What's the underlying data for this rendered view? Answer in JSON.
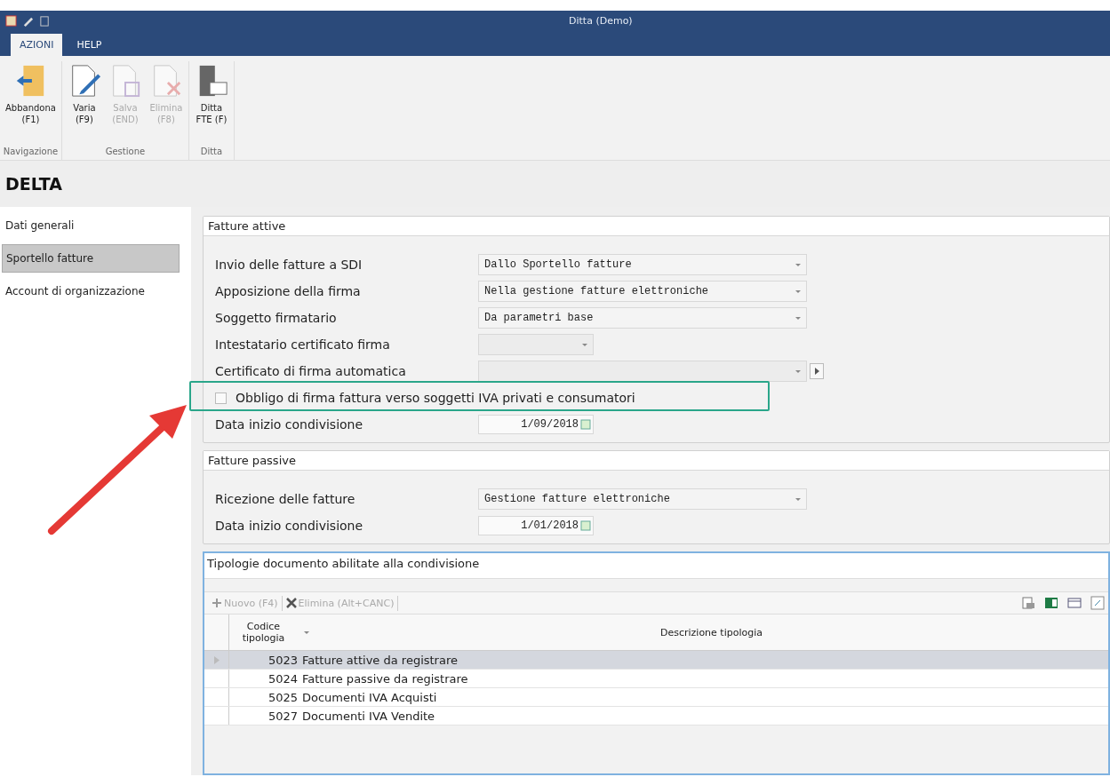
{
  "window": {
    "title": "Ditta (Demo)"
  },
  "tabs": [
    {
      "label": "AZIONI",
      "selected": true
    },
    {
      "label": "HELP",
      "selected": false
    }
  ],
  "ribbon": {
    "groups": [
      {
        "label": "Navigazione",
        "buttons": [
          {
            "kind": "exit",
            "line1": "Abbandona",
            "line2": "(F1)",
            "disabled": false
          }
        ]
      },
      {
        "label": "Gestione",
        "buttons": [
          {
            "kind": "edit",
            "line1": "Varia",
            "line2": "(F9)",
            "disabled": false
          },
          {
            "kind": "save",
            "line1": "Salva",
            "line2": "(END)",
            "disabled": true
          },
          {
            "kind": "delete",
            "line1": "Elimina",
            "line2": "(F8)",
            "disabled": true
          }
        ]
      },
      {
        "label": "Ditta",
        "buttons": [
          {
            "kind": "company",
            "line1": "Ditta",
            "line2": "FTE (F)",
            "disabled": false
          }
        ]
      }
    ]
  },
  "page_title": "DELTA",
  "sidebar": {
    "items": [
      {
        "label": "Dati generali",
        "selected": false
      },
      {
        "label": "Sportello fatture",
        "selected": true
      },
      {
        "label": "Account di organizzazione",
        "selected": false
      }
    ]
  },
  "sections": [
    {
      "title": "Fatture attive",
      "fields": [
        {
          "kind": "select",
          "label": "Invio delle fatture a SDI",
          "value": "Dallo Sportello fatture"
        },
        {
          "kind": "select",
          "label": "Apposizione della firma",
          "value": "Nella gestione fatture elettroniche"
        },
        {
          "kind": "select",
          "label": "Soggetto firmatario",
          "value": "Da parametri base"
        },
        {
          "kind": "small-select",
          "label": "Intestatario certificato firma"
        },
        {
          "kind": "select-button",
          "label": "Certificato di firma automatica"
        },
        {
          "kind": "checkbox",
          "label": "Obbligo di firma fattura verso soggetti IVA privati e consumatori",
          "checked": false
        },
        {
          "kind": "date",
          "label": "Data inizio condivisione",
          "value": "1/09/2018"
        }
      ]
    },
    {
      "title": "Fatture passive",
      "fields": [
        {
          "kind": "select",
          "label": "Ricezione delle fatture",
          "value": "Gestione fatture elettroniche"
        },
        {
          "kind": "date",
          "label": "Data inizio condivisione",
          "value": "1/01/2018"
        }
      ]
    }
  ],
  "grid": {
    "title": "Tipologie documento abilitate alla condivisione",
    "toolbar": [
      {
        "kind": "add",
        "label": "Nuovo (F4)",
        "disabled": true
      },
      {
        "kind": "remove",
        "label": "Elimina (Alt+CANC)",
        "disabled": true
      }
    ],
    "columns": [
      "Codice tipologia",
      "Descrizione tipologia"
    ],
    "rows": [
      {
        "code": "5023",
        "description": "Fatture attive da registrare",
        "selected": true
      },
      {
        "code": "5024",
        "description": "Fatture passive da registrare",
        "selected": false
      },
      {
        "code": "5025",
        "description": "Documenti IVA Acquisti",
        "selected": false
      },
      {
        "code": "5027",
        "description": "Documenti IVA Vendite",
        "selected": false
      }
    ]
  }
}
